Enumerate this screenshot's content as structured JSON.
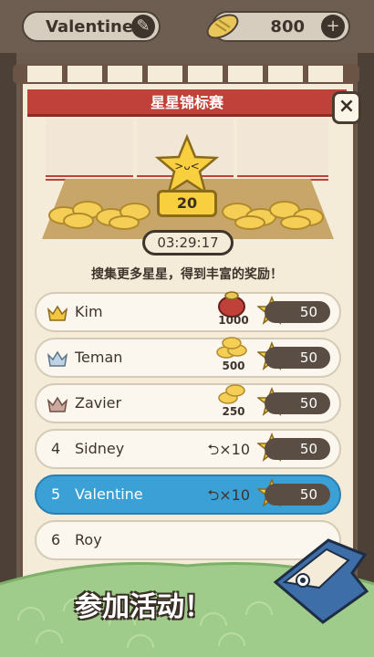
{
  "header": {
    "player_name": "Valentine",
    "coins": "800",
    "edit_icon": "pencil-icon",
    "add_icon": "plus-icon"
  },
  "event": {
    "title": "星星锦标赛",
    "star_count": "20",
    "timer": "03:29:17",
    "subtitle": "搜集更多星星，得到丰富的奖励！"
  },
  "leaderboard": [
    {
      "rank": "",
      "medal": "gold-crown",
      "name": "Kim",
      "reward": "1000",
      "reward_icon": "coin-bag-icon",
      "score": "50"
    },
    {
      "rank": "",
      "medal": "silver-crown",
      "name": "Teman",
      "reward": "500",
      "reward_icon": "coin-pile-icon",
      "score": "50"
    },
    {
      "rank": "",
      "medal": "bronze-crown",
      "name": "Zavier",
      "reward": "250",
      "reward_icon": "coin-pile-icon",
      "score": "50"
    },
    {
      "rank": "4",
      "medal": "",
      "name": "Sidney",
      "reward": "×10",
      "reward_icon": "undo-icon",
      "score": "50"
    },
    {
      "rank": "5",
      "medal": "",
      "name": "Valentine",
      "reward": "×10",
      "reward_icon": "undo-icon",
      "score": "50",
      "highlight": true
    },
    {
      "rank": "6",
      "medal": "",
      "name": "Roy",
      "reward": "",
      "reward_icon": "",
      "score": ""
    }
  ],
  "cta": "参加活动！",
  "colors": {
    "banner": "#c0413a",
    "highlight": "#3aa0d6",
    "gold": "#f8cf3e"
  }
}
